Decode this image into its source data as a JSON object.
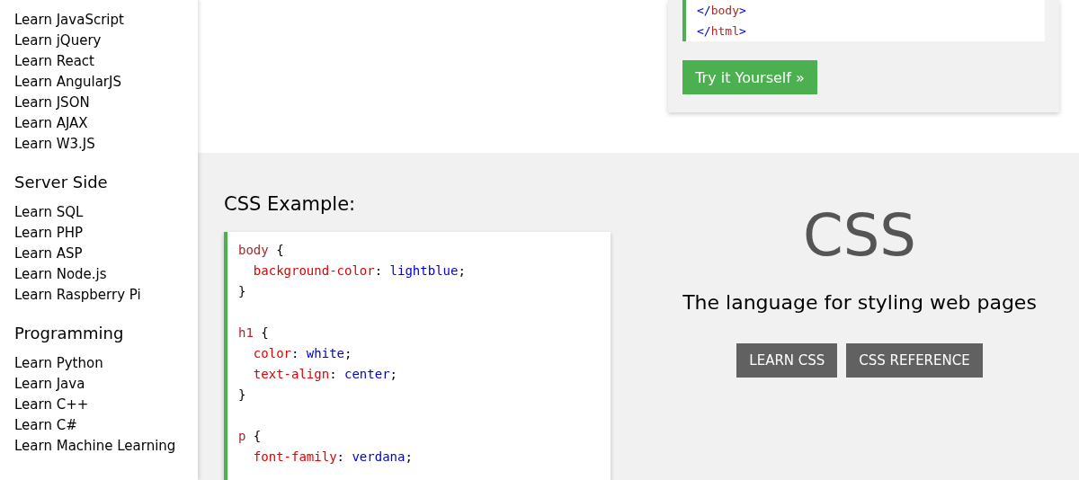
{
  "sidebar": {
    "groups": [
      {
        "items": [
          "Learn JavaScript",
          "Learn jQuery",
          "Learn React",
          "Learn AngularJS",
          "Learn JSON",
          "Learn AJAX",
          "Learn W3.JS"
        ]
      },
      {
        "heading": "Server Side",
        "items": [
          "Learn SQL",
          "Learn PHP",
          "Learn ASP",
          "Learn Node.js",
          "Learn Raspberry Pi"
        ]
      },
      {
        "heading": "Programming",
        "items": [
          "Learn Python",
          "Learn Java",
          "Learn C++",
          "Learn C#",
          "Learn Machine Learning"
        ]
      }
    ]
  },
  "html_example": {
    "code_lines": [
      [
        {
          "kind": "bracket",
          "text": "</"
        },
        {
          "kind": "tag",
          "text": "body"
        },
        {
          "kind": "bracket",
          "text": ">"
        }
      ],
      [
        {
          "kind": "bracket",
          "text": "</"
        },
        {
          "kind": "tag",
          "text": "html"
        },
        {
          "kind": "bracket",
          "text": ">"
        }
      ]
    ],
    "button": "Try it Yourself »"
  },
  "css_example": {
    "title": "CSS Example:",
    "blocks": [
      [
        {
          "indented": false,
          "tokens": [
            {
              "kind": "selector",
              "text": "body"
            },
            {
              "kind": "punct",
              "text": " {"
            }
          ]
        },
        {
          "indented": true,
          "tokens": [
            {
              "kind": "property",
              "text": "background-color"
            },
            {
              "kind": "punct",
              "text": ":"
            },
            {
              "kind": "value",
              "text": " lightblue"
            },
            {
              "kind": "punct",
              "text": ";"
            }
          ]
        },
        {
          "indented": false,
          "tokens": [
            {
              "kind": "punct",
              "text": "}"
            }
          ]
        }
      ],
      [
        {
          "indented": false,
          "tokens": [
            {
              "kind": "selector",
              "text": "h1"
            },
            {
              "kind": "punct",
              "text": " {"
            }
          ]
        },
        {
          "indented": true,
          "tokens": [
            {
              "kind": "property",
              "text": "color"
            },
            {
              "kind": "punct",
              "text": ":"
            },
            {
              "kind": "value",
              "text": " white"
            },
            {
              "kind": "punct",
              "text": ";"
            }
          ]
        },
        {
          "indented": true,
          "tokens": [
            {
              "kind": "property",
              "text": "text-align"
            },
            {
              "kind": "punct",
              "text": ":"
            },
            {
              "kind": "value",
              "text": " center"
            },
            {
              "kind": "punct",
              "text": ";"
            }
          ]
        },
        {
          "indented": false,
          "tokens": [
            {
              "kind": "punct",
              "text": "}"
            }
          ]
        }
      ],
      [
        {
          "indented": false,
          "tokens": [
            {
              "kind": "selector",
              "text": "p"
            },
            {
              "kind": "punct",
              "text": " {"
            }
          ]
        },
        {
          "indented": true,
          "tokens": [
            {
              "kind": "property",
              "text": "font-family"
            },
            {
              "kind": "punct",
              "text": ":"
            },
            {
              "kind": "value",
              "text": " verdana"
            },
            {
              "kind": "punct",
              "text": ";"
            }
          ]
        }
      ]
    ]
  },
  "promo": {
    "title": "CSS",
    "tagline": "The language for styling web pages",
    "buttons": [
      "LEARN CSS",
      "CSS REFERENCE"
    ]
  }
}
